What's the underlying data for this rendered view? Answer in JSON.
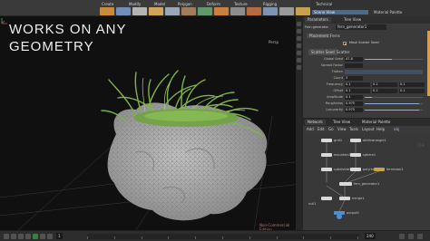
{
  "overlay_title_line1": "WORKS ON ANY",
  "overlay_title_line2": "GEOMETRY",
  "shelf": {
    "tabs": [
      "Create",
      "Modify",
      "Model",
      "Polygon",
      "Deform",
      "Texture",
      "Rigging"
    ],
    "icon_colors": [
      "#c98a3a",
      "#6f8fb8",
      "#b4b4b4",
      "#d1a45a",
      "#9aa6b6",
      "#a07b5c",
      "#5f9a6c",
      "#c9803e",
      "#8c8c8c",
      "#b96b3f",
      "#7d93b2",
      "#9a9a9a",
      "#c8a04f"
    ]
  },
  "right_header": {
    "desktop_label": "Technical",
    "pane_tabs": [
      "Scene View",
      "Material Palette"
    ],
    "param_tab": "Parameters",
    "tree_tab": "Tree View"
  },
  "param_pane": {
    "node_type": "Fern generator",
    "node_name": "fern_generator1",
    "folder_tabs": [
      "Placement",
      "Ferns"
    ],
    "subtabs": [
      "Scatter Seed",
      "Scatter"
    ],
    "checkbox_label": "Mask Scatter Seed",
    "rows": [
      {
        "label": "Global Seed",
        "value": "47.8"
      },
      {
        "label": "Spread Factor",
        "value": ""
      },
      {
        "label": "Flatten",
        "value": ""
      },
      {
        "label": "Count",
        "value": "3"
      },
      {
        "label": "Frequency",
        "value": "0.1"
      },
      {
        "label": "Offset",
        "value": "0.1"
      },
      {
        "label": "Amplitude",
        "value": "0.1"
      },
      {
        "label": "Roughness",
        "value": "0.975"
      },
      {
        "label": "Lacunarity",
        "value": "0.975"
      }
    ]
  },
  "net_pane": {
    "tabs": [
      "Network",
      "Tree View",
      "Material Palette"
    ],
    "menu": [
      "Add",
      "Edit",
      "Go",
      "View",
      "Tools",
      "Layout",
      "Help"
    ],
    "path": "obj",
    "bg_letters": "Ge",
    "nodes": [
      {
        "name": "grid1",
        "color": "#d9d9d9"
      },
      {
        "name": "mountain1",
        "color": "#d9d9d9"
      },
      {
        "name": "subdivide1",
        "color": "#d9d9d9"
      },
      {
        "name": "attribwrangle1",
        "color": "#d9d9d9"
      },
      {
        "name": "fern_generator1",
        "color": "#d9d9d9"
      },
      {
        "name": "output0",
        "color": "#4a8fd0"
      },
      {
        "name": "sphere1",
        "color": "#d9d9d9"
      },
      {
        "name": "polyreduce1",
        "color": "#d9d9d9"
      },
      {
        "name": "null1",
        "color": "#d9d9d9"
      },
      {
        "name": "merge1",
        "color": "#d9d9d9"
      },
      {
        "name": "fernmask1",
        "color": "#c7a34a"
      }
    ]
  },
  "viewport": {
    "camera_label": "Persp",
    "bottom_label": "Non-Commercial Edition"
  },
  "timeline": {
    "frame": "1",
    "end_frame": "240",
    "ticks": [
      "1",
      "24",
      "48",
      "72",
      "96",
      "120",
      "144",
      "168",
      "192",
      "216",
      "240"
    ]
  },
  "colors": {
    "accent": "#e49b31",
    "selection": "#4a6a92",
    "grass": "#7fb34a",
    "rock": "#a9a9a9"
  }
}
